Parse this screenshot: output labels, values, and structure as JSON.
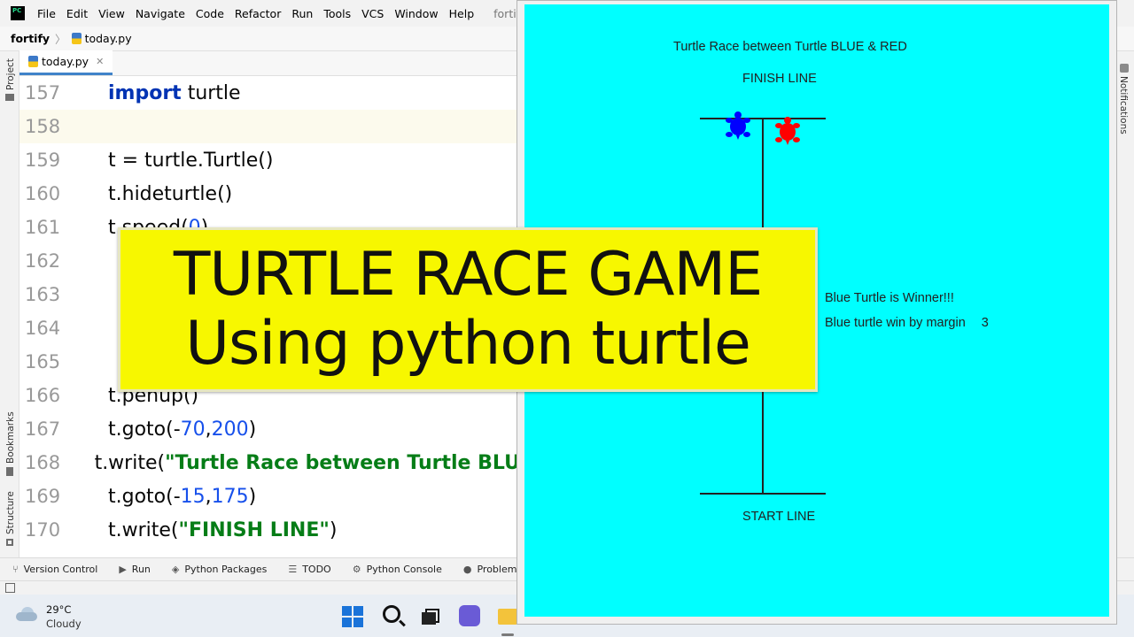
{
  "ide": {
    "menu": [
      "File",
      "Edit",
      "View",
      "Navigate",
      "Code",
      "Refactor",
      "Run",
      "Tools",
      "VCS",
      "Window",
      "Help"
    ],
    "window_title": "fortify - tod",
    "breadcrumb": {
      "project": "fortify",
      "file": "today.py"
    },
    "left_tools": [
      "Project",
      "Bookmarks",
      "Structure"
    ],
    "right_tools": [
      "Notifications"
    ],
    "tab": {
      "label": "today.py"
    },
    "code_lines": [
      {
        "ln": "157",
        "current": false,
        "tokens": [
          {
            "t": "import",
            "c": "kw"
          },
          {
            "t": " turtle",
            "c": ""
          }
        ]
      },
      {
        "ln": "158",
        "current": true,
        "tokens": []
      },
      {
        "ln": "159",
        "current": false,
        "tokens": [
          {
            "t": "t = turtle.Turtle()",
            "c": ""
          }
        ]
      },
      {
        "ln": "160",
        "current": false,
        "tokens": [
          {
            "t": "t.hideturtle()",
            "c": ""
          }
        ]
      },
      {
        "ln": "161",
        "current": false,
        "tokens": [
          {
            "t": "t.speed(",
            "c": ""
          },
          {
            "t": "0",
            "c": "num"
          },
          {
            "t": ")",
            "c": ""
          }
        ]
      },
      {
        "ln": "162",
        "current": false,
        "tokens": []
      },
      {
        "ln": "163",
        "current": false,
        "tokens": []
      },
      {
        "ln": "164",
        "current": false,
        "tokens": []
      },
      {
        "ln": "165",
        "current": false,
        "tokens": []
      },
      {
        "ln": "166",
        "current": false,
        "tokens": [
          {
            "t": "t.penup()",
            "c": ""
          }
        ]
      },
      {
        "ln": "167",
        "current": false,
        "tokens": [
          {
            "t": "t.goto(-",
            "c": ""
          },
          {
            "t": "70",
            "c": "num"
          },
          {
            "t": ",",
            "c": ""
          },
          {
            "t": "200",
            "c": "num"
          },
          {
            "t": ")",
            "c": ""
          }
        ]
      },
      {
        "ln": "168",
        "current": false,
        "tokens": [
          {
            "t": "t.write(",
            "c": ""
          },
          {
            "t": "\"Turtle Race between Turtle BLUE",
            "c": "str"
          }
        ]
      },
      {
        "ln": "169",
        "current": false,
        "tokens": [
          {
            "t": "t.goto(-",
            "c": ""
          },
          {
            "t": "15",
            "c": "num"
          },
          {
            "t": ",",
            "c": ""
          },
          {
            "t": "175",
            "c": "num"
          },
          {
            "t": ")",
            "c": ""
          }
        ]
      },
      {
        "ln": "170",
        "current": false,
        "tokens": [
          {
            "t": "t.write(",
            "c": ""
          },
          {
            "t": "\"FINISH LINE\"",
            "c": "str"
          },
          {
            "t": ")",
            "c": ""
          }
        ]
      }
    ],
    "bottom_tools": [
      {
        "label": "Version Control",
        "icon": "branch-icon",
        "glyph": "⑂"
      },
      {
        "label": "Run",
        "icon": "run-icon",
        "glyph": "▶"
      },
      {
        "label": "Python Packages",
        "icon": "packages-icon",
        "glyph": "◈"
      },
      {
        "label": "TODO",
        "icon": "todo-icon",
        "glyph": "☰"
      },
      {
        "label": "Python Console",
        "icon": "console-icon",
        "glyph": "⚙"
      },
      {
        "label": "Problems",
        "icon": "problems-icon",
        "glyph": "●"
      }
    ]
  },
  "turtle_window": {
    "title_text": "Turtle Race between Turtle BLUE & RED",
    "finish_label": "FINISH LINE",
    "start_label": "START LINE",
    "winner_text": "Blue Turtle is Winner!!!",
    "margin_text": "Blue turtle win by margin",
    "margin_value": "3",
    "background": "#00ffff",
    "turtles": [
      {
        "name": "blue",
        "color": "#0000ff"
      },
      {
        "name": "red",
        "color": "#ff0000"
      }
    ]
  },
  "banner": {
    "line1": "TURTLE RACE GAME",
    "line2": "Using python turtle",
    "color": "#f7f700"
  },
  "taskbar": {
    "weather_temp": "29°C",
    "weather_desc": "Cloudy"
  }
}
